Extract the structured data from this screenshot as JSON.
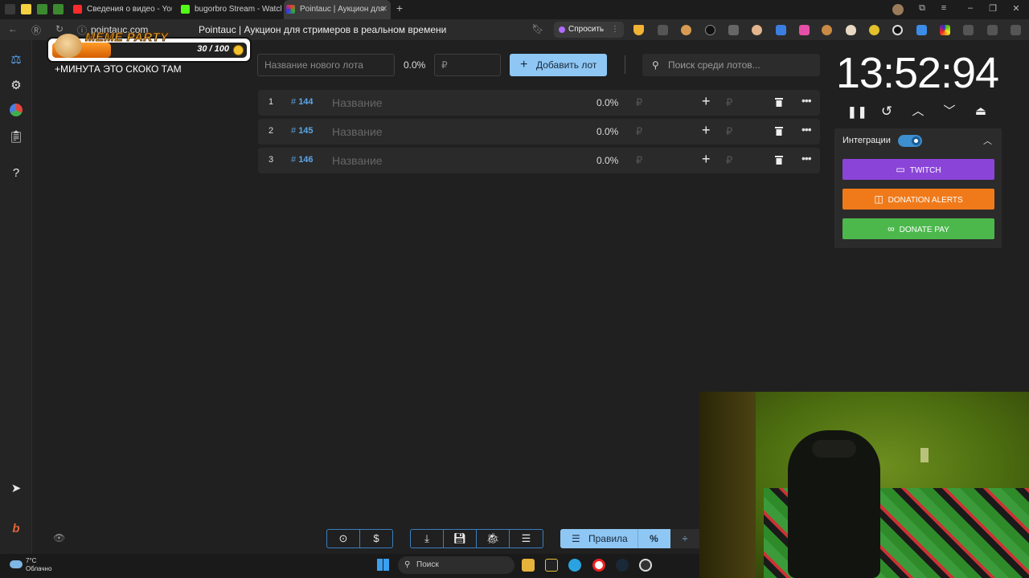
{
  "browser": {
    "tabs": [
      {
        "label": "Сведения о видео - YouTube",
        "active": false
      },
      {
        "label": "bugorbro Stream - Watch",
        "active": false
      },
      {
        "label": "Pointauc | Аукцион для",
        "active": true
      }
    ],
    "url": "pointauc.com",
    "page_title": "Pointauc | Аукцион для стримеров в реальном времени",
    "ask_label": "Спросить"
  },
  "overlay": {
    "logo_text": "MEME PARTY",
    "counter": "30 / 100",
    "progress": 0.3,
    "caption": "+МИНУТА ЭТО СКОКО ТАМ"
  },
  "toolbar": {
    "lot_name_placeholder": "Название нового лота",
    "percent": "0.0%",
    "amount_placeholder": "₽",
    "add_button": "Добавить лот",
    "search_placeholder": "Поиск среди лотов..."
  },
  "lots": [
    {
      "num": "1",
      "id": "144",
      "name": "Название",
      "percent": "0.0%",
      "currency": "₽"
    },
    {
      "num": "2",
      "id": "145",
      "name": "Название",
      "percent": "0.0%",
      "currency": "₽"
    },
    {
      "num": "3",
      "id": "146",
      "name": "Название",
      "percent": "0.0%",
      "currency": "₽"
    }
  ],
  "timer": {
    "value": "13:52:94"
  },
  "integrations": {
    "title": "Интеграции",
    "enabled": true,
    "buttons": [
      {
        "label": "TWITCH",
        "color": "#8b44d8"
      },
      {
        "label": "DONATION ALERTS",
        "color": "#f07a1a"
      },
      {
        "label": "DONATE PAY",
        "color": "#4cb84c"
      }
    ]
  },
  "bottom": {
    "rules_label": "Правила"
  },
  "taskbar": {
    "temperature": "7°C",
    "weather": "Облачно",
    "search_label": "Поиск"
  },
  "colors": {
    "accent": "#8fc7f4",
    "lot_id": "#5ba6e8",
    "twitch": "#8b44d8",
    "donation_alerts": "#f07a1a",
    "donate_pay": "#4cb84c"
  }
}
